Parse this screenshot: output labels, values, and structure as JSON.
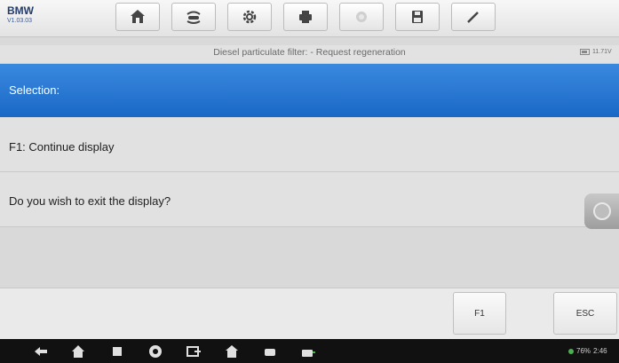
{
  "app": {
    "brand": "BMW",
    "version": "V1.03.03"
  },
  "toolbar": {
    "buttons": [
      {
        "name": "home-icon"
      },
      {
        "name": "vehicle-swap-icon"
      },
      {
        "name": "gear-icon"
      },
      {
        "name": "printer-icon"
      },
      {
        "name": "help-icon"
      },
      {
        "name": "save-icon"
      },
      {
        "name": "pen-icon"
      }
    ]
  },
  "subtitle": "Diesel particulate filter: - Request regeneration",
  "battery_voltage": "11.71V",
  "selection_label": "Selection:",
  "rows": [
    {
      "text": "F1: Continue display"
    },
    {
      "text": "Do you wish to exit the display?"
    }
  ],
  "function_buttons": {
    "f1": "F1",
    "esc": "ESC"
  },
  "navbar": {
    "icons": [
      "back-icon",
      "home-icon",
      "recent-apps-icon",
      "chrome-icon",
      "screen-capture-icon",
      "maxisys-icon",
      "car-icon",
      "vci-icon"
    ],
    "status": "76%",
    "time": "2:46"
  },
  "colors": {
    "selection_blue": "#1a68c6",
    "row_bg": "#e1e1e1"
  }
}
